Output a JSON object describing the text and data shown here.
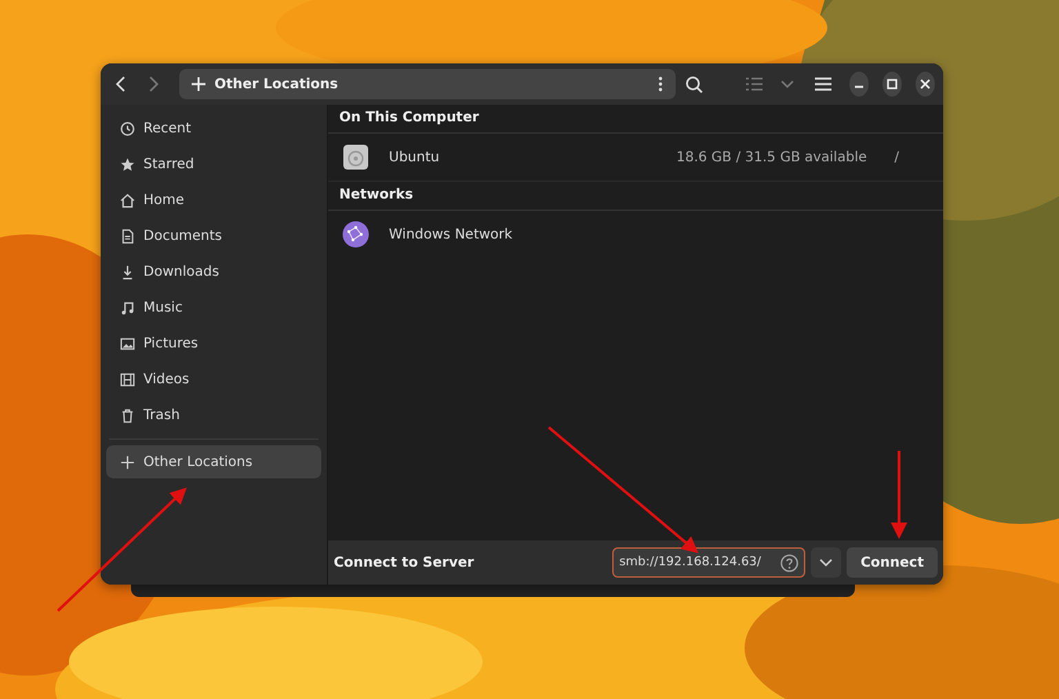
{
  "header": {
    "location": "Other Locations"
  },
  "sidebar": {
    "items": [
      {
        "label": "Recent",
        "selected": false
      },
      {
        "label": "Starred",
        "selected": false
      },
      {
        "label": "Home",
        "selected": false
      },
      {
        "label": "Documents",
        "selected": false
      },
      {
        "label": "Downloads",
        "selected": false
      },
      {
        "label": "Music",
        "selected": false
      },
      {
        "label": "Pictures",
        "selected": false
      },
      {
        "label": "Videos",
        "selected": false
      },
      {
        "label": "Trash",
        "selected": false
      }
    ],
    "other": {
      "label": "Other Locations",
      "selected": true
    }
  },
  "sections": [
    {
      "title": "On This Computer",
      "rows": [
        {
          "kind": "drive",
          "name": "Ubuntu",
          "usage": "18.6 GB / 31.5 GB available",
          "mount": "/"
        }
      ]
    },
    {
      "title": "Networks",
      "rows": [
        {
          "kind": "network",
          "name": "Windows Network"
        }
      ]
    }
  ],
  "connect": {
    "label": "Connect to Server",
    "value": "smb://192.168.124.63/",
    "button": "Connect"
  }
}
